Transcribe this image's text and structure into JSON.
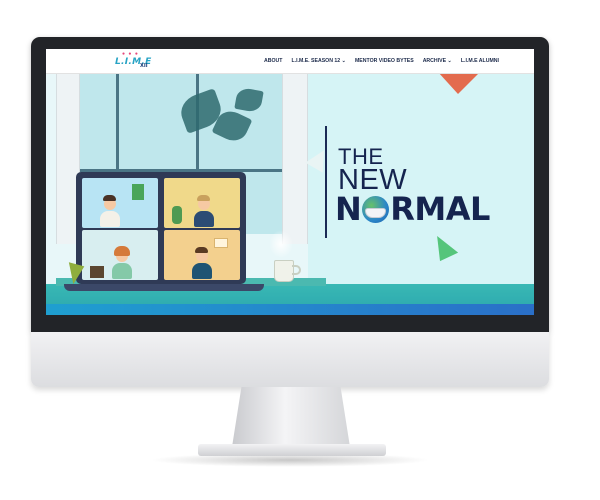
{
  "site": {
    "logo_text": "L.I.M.E",
    "logo_sub": "XII"
  },
  "nav": {
    "items": [
      {
        "label": "ABOUT"
      },
      {
        "label": "L.I.M.E. SEASON 12 ⌄"
      },
      {
        "label": "MENTOR VIDEO BYTES"
      },
      {
        "label": "ARCHIVE ⌄"
      },
      {
        "label": "L.I.M.E ALUMNI"
      }
    ]
  },
  "hero": {
    "line1": "THE",
    "line2": "NEW",
    "line3_a": "N",
    "line3_b": "RMAL"
  },
  "colors": {
    "accent": "#15244f",
    "teal": "#39b8b4",
    "sky": "#d6f4f6",
    "blue_strip": "#2a6fc8"
  }
}
